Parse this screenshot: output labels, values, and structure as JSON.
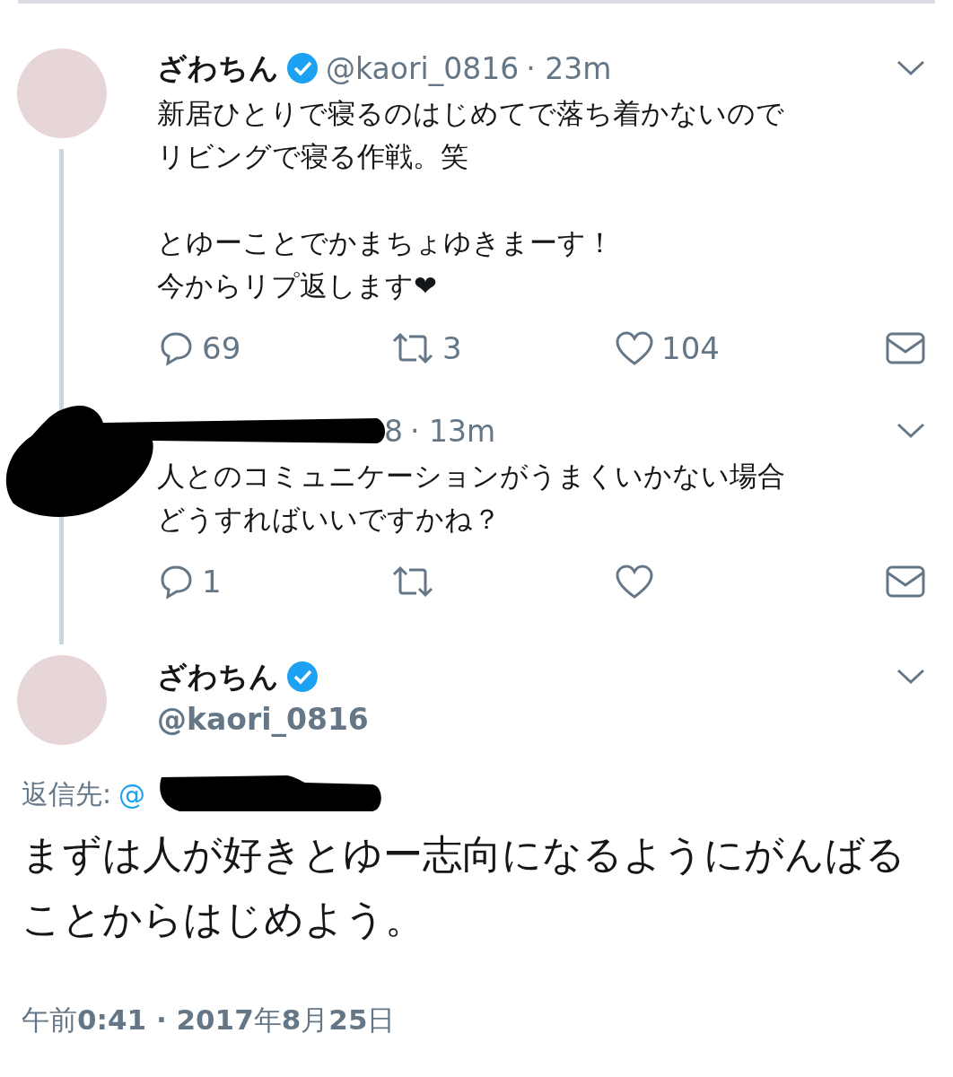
{
  "tweets": [
    {
      "name": "ざわちん",
      "verified": true,
      "handle": "@kaori_0816",
      "time": "· 23m",
      "paragraphs": [
        [
          "新居ひとりで寝るのはじめてで落ち着かないので",
          "リビングで寝る作戦。笑"
        ],
        [
          "とゆーことでかまちょゆきまーす！",
          "今からリプ返します❤"
        ]
      ],
      "redacted": false,
      "actions": [
        {
          "kind": "reply",
          "count": "69"
        },
        {
          "kind": "retweet",
          "count": "3"
        },
        {
          "kind": "like",
          "count": "104"
        },
        {
          "kind": "message"
        }
      ]
    },
    {
      "handle": "8",
      "time": "· 13m",
      "paragraphs": [
        [
          "人とのコミュニケーションがうまくいかない場合",
          "どうすればいいですかね？"
        ]
      ],
      "redacted": true,
      "actions": [
        {
          "kind": "reply",
          "count": "1"
        },
        {
          "kind": "retweet"
        },
        {
          "kind": "like"
        },
        {
          "kind": "message"
        }
      ]
    }
  ],
  "main": {
    "name": "ざわちん",
    "verified": true,
    "handle": "@kaori_0816",
    "reply_label": "返信先:",
    "reply_handle": "@",
    "text": "まずは人が好きとゆー志向になるようにがんばることからはじめよう。",
    "timestamp": "午前**0:41 · 2017**年**8**月**25**日"
  }
}
